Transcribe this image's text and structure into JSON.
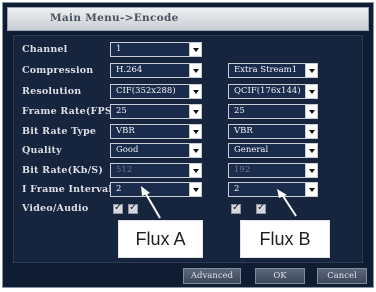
{
  "title": "Main Menu->Encode",
  "rows": [
    {
      "label": "Channel",
      "a": "1",
      "b": null
    },
    {
      "label": "Compression",
      "a": "H.264",
      "b": "Extra Stream1"
    },
    {
      "label": "Resolution",
      "a": "CIF(352x288)",
      "b": "QCIF(176x144)"
    },
    {
      "label": "Frame Rate(FPS)",
      "a": "25",
      "b": "25"
    },
    {
      "label": "Bit Rate Type",
      "a": "VBR",
      "b": "VBR"
    },
    {
      "label": "Quality",
      "a": "Good",
      "b": "General"
    },
    {
      "label": "Bit Rate(Kb/S)",
      "a": "512",
      "b": "192"
    },
    {
      "label": "I Frame Interval",
      "a": "2",
      "b": "2"
    },
    {
      "label": "Video/Audio",
      "a": null,
      "b": null
    }
  ],
  "video_audio": {
    "a_video": true,
    "a_audio": true,
    "b_video": true,
    "b_audio": true
  },
  "callouts": {
    "a": "Flux A",
    "b": "Flux B"
  },
  "buttons": {
    "advanced": "Advanced",
    "ok": "OK",
    "cancel": "Cancel"
  }
}
